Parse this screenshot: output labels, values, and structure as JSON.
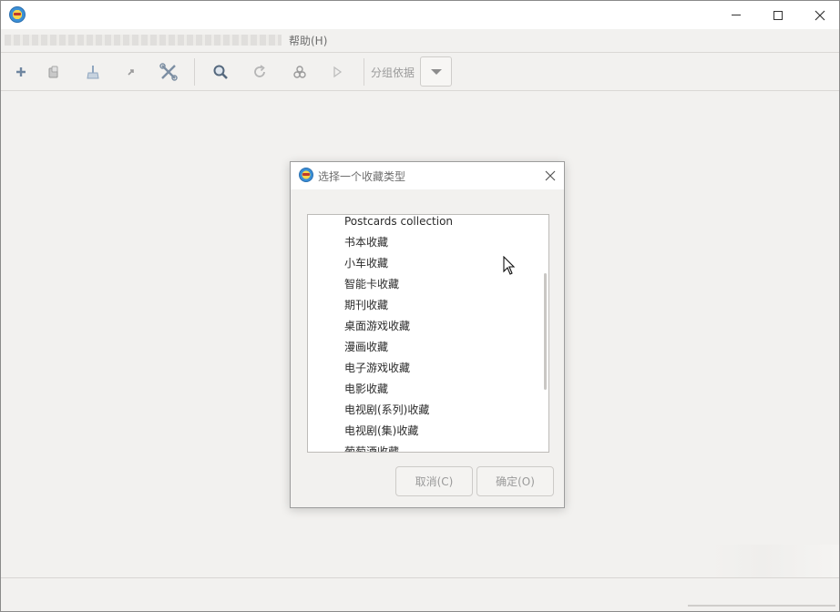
{
  "window": {
    "title": "",
    "controls": {
      "minimize": "minimize",
      "maximize": "maximize",
      "close": "close"
    }
  },
  "menubar": {
    "help_label": "帮助(H)"
  },
  "toolbar": {
    "buttons": [
      {
        "name": "add",
        "icon": "plus-icon"
      },
      {
        "name": "copy",
        "icon": "copy-icon"
      },
      {
        "name": "clean",
        "icon": "clean-icon"
      },
      {
        "name": "export",
        "icon": "export-icon"
      },
      {
        "name": "settings",
        "icon": "tools-icon"
      },
      {
        "name": "search",
        "icon": "search-icon"
      },
      {
        "name": "refresh",
        "icon": "refresh-icon"
      },
      {
        "name": "plugins",
        "icon": "plugin-icon"
      },
      {
        "name": "play",
        "icon": "play-icon"
      }
    ],
    "group_by_label": "分组依据"
  },
  "dialog": {
    "title": "选择一个收藏类型",
    "items": [
      "Postcards collection",
      "书本收藏",
      "小车收藏",
      "智能卡收藏",
      "期刊收藏",
      "桌面游戏收藏",
      "漫画收藏",
      "电子游戏收藏",
      "电影收藏",
      "电视剧(系列)收藏",
      "电视剧(集)收藏",
      "葡萄酒收藏"
    ],
    "cancel_label": "取消(C)",
    "ok_label": "确定(O)"
  },
  "colors": {
    "background": "#f2f1ef",
    "titlebar": "#ffffff",
    "disabled_text": "#9a9a9a",
    "toolbar_icon": "#7a8a9a"
  }
}
